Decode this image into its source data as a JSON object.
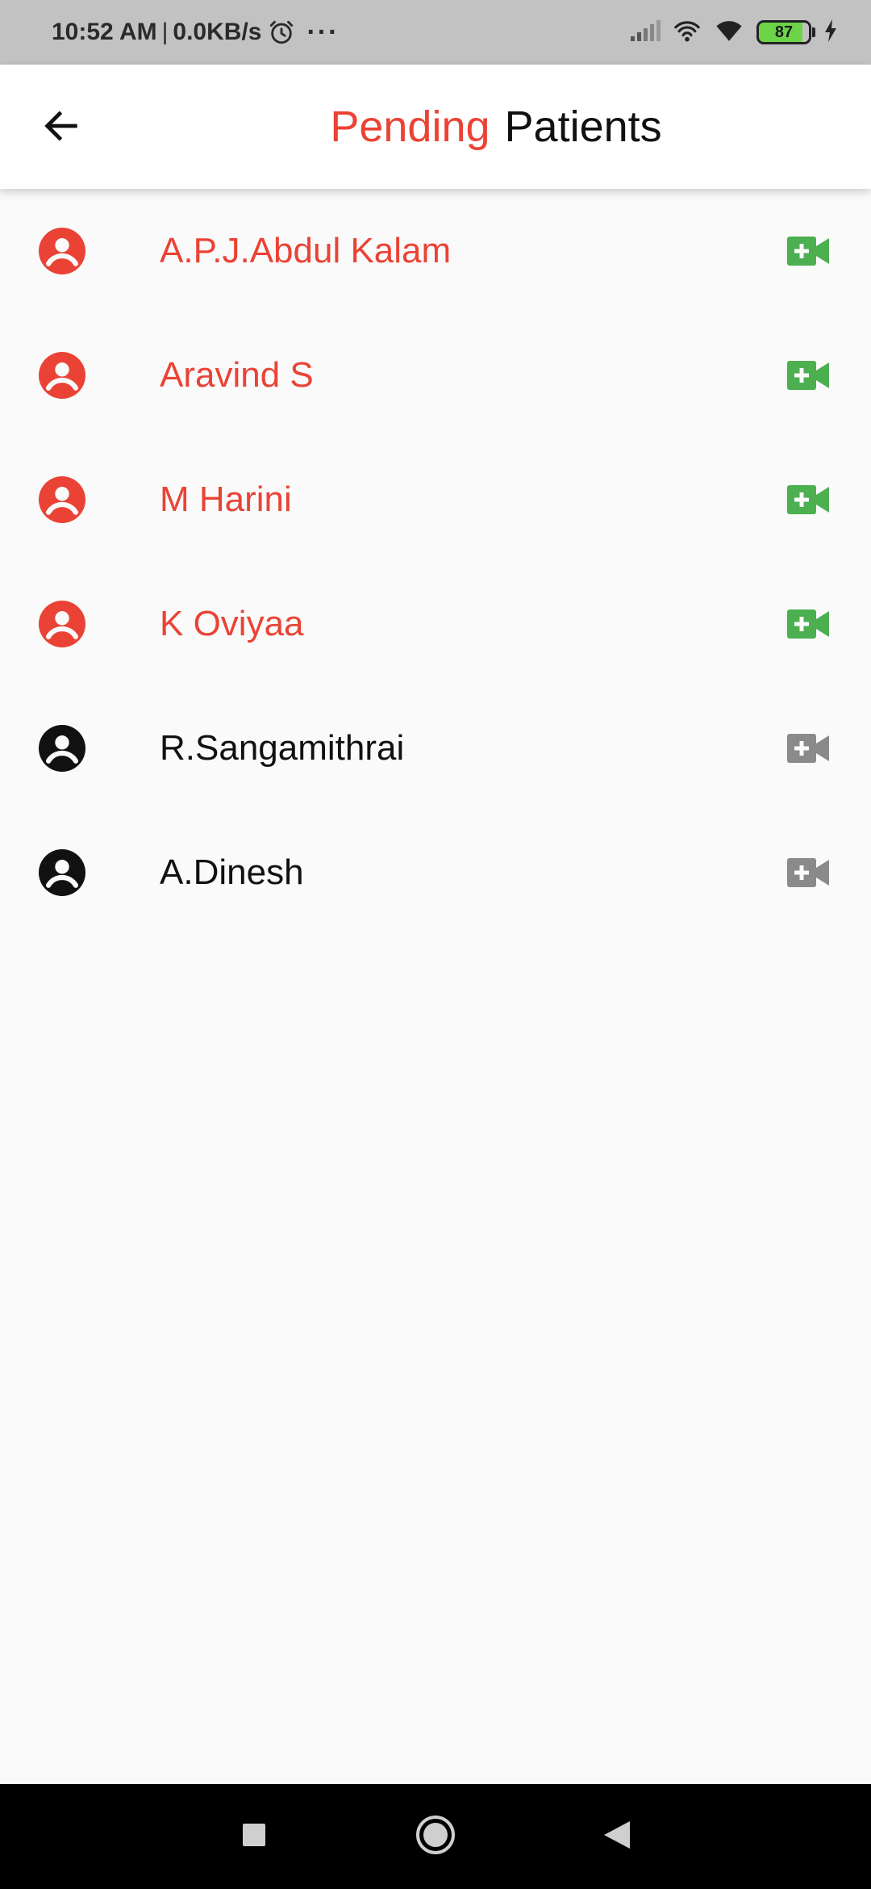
{
  "status_bar": {
    "time": "10:52 AM",
    "separator": "|",
    "network_speed": "0.0KB/s",
    "more": "···",
    "battery_level": "87",
    "icons": [
      "alarm-icon",
      "signal-icon",
      "hotspot-icon",
      "wifi-icon",
      "battery-icon",
      "charging-icon"
    ]
  },
  "app_bar": {
    "back_icon": "arrow-left-icon",
    "title_accent": "Pending",
    "title_rest": "Patients"
  },
  "colors": {
    "accent": "#ea4335",
    "video_active": "#4caf50",
    "video_inactive": "#8a8a8a",
    "text_dark": "#111111",
    "background": "#fafafa"
  },
  "patients": [
    {
      "name": "A.P.J.Abdul Kalam",
      "state": "active"
    },
    {
      "name": "Aravind S",
      "state": "active"
    },
    {
      "name": "M Harini",
      "state": "active"
    },
    {
      "name": "K Oviyaa",
      "state": "active"
    },
    {
      "name": "R.Sangamithrai",
      "state": "inactive"
    },
    {
      "name": "A.Dinesh",
      "state": "inactive"
    }
  ],
  "nav_bar": {
    "icons": [
      "recents-square-icon",
      "home-circle-icon",
      "back-triangle-icon"
    ]
  }
}
